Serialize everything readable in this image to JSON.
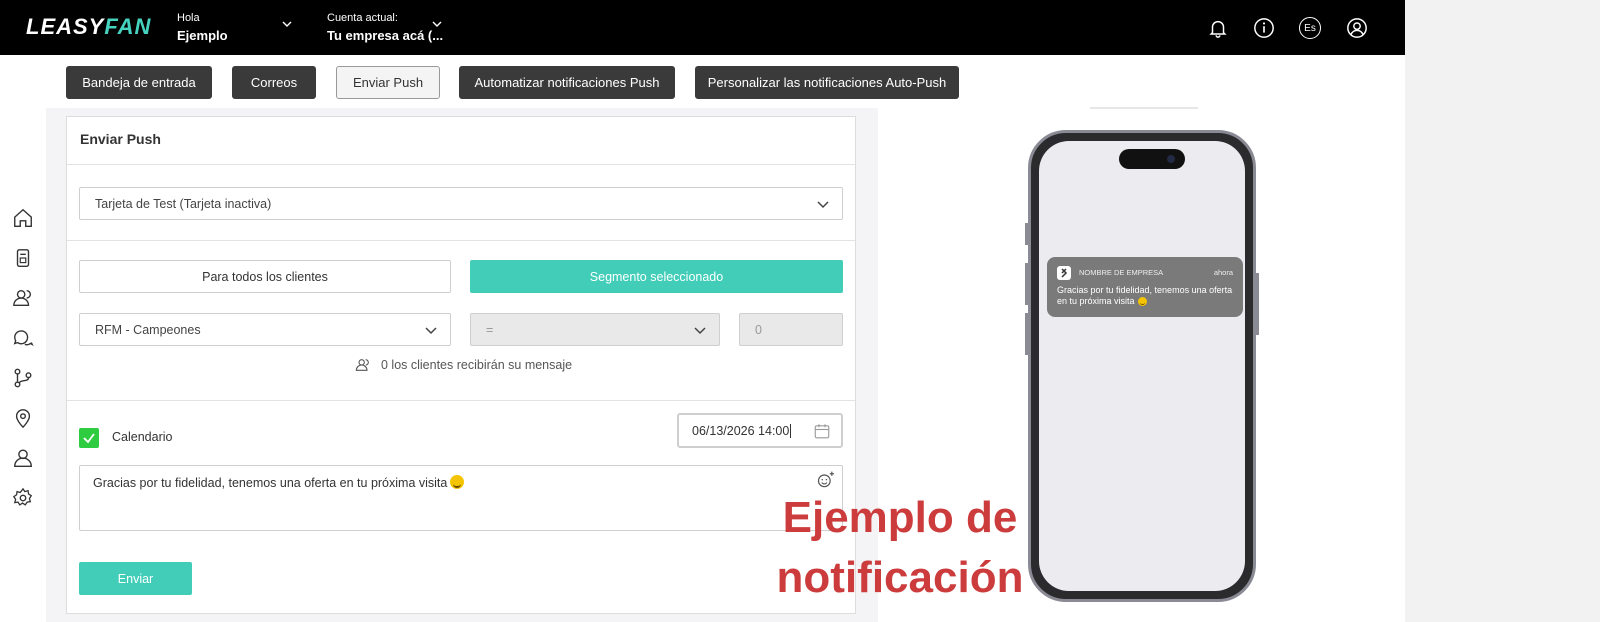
{
  "header": {
    "logo_main": "LEASY",
    "logo_accent": "FAN",
    "greeting_label": "Hola",
    "user_name": "Ejemplo",
    "account_label": "Cuenta actual:",
    "account_name": "Tu empresa acá (..."
  },
  "header_icons": [
    "bell-icon",
    "info-icon",
    "language-icon",
    "user-icon"
  ],
  "language_code": "Es",
  "tabs": [
    {
      "label": "Bandeja de entrada"
    },
    {
      "label": "Correos"
    },
    {
      "label": "Enviar Push"
    },
    {
      "label": "Automatizar notificaciones Push"
    },
    {
      "label": "Personalizar las notificaciones Auto-Push"
    }
  ],
  "sidebar_icons": [
    "home-icon",
    "card-icon",
    "clients-icon",
    "chat-icon",
    "flow-icon",
    "location-icon",
    "person-icon",
    "settings-icon"
  ],
  "form": {
    "title": "Enviar Push",
    "card_select": "Tarjeta de Test (Tarjeta inactiva)",
    "all_clients_label": "Para todos los clientes",
    "segment_label": "Segmento seleccionado",
    "segment_select": "RFM - Campeones",
    "operator_select": "=",
    "value_input": "0",
    "recipients_text": "0 los clientes recibirán su mensaje",
    "calendar_label": "Calendario",
    "calendar_checked": true,
    "date_value": "06/13/2026 14:00",
    "message": "Gracias por tu fidelidad, tenemos una oferta en tu próxima visita",
    "send_label": "Enviar"
  },
  "example_title_line1": "Ejemplo de",
  "example_title_line2": "notificación",
  "phone_notification": {
    "company": "NOMBRE DE EMPRESA",
    "time": "ahora",
    "message": "Gracias por tu fidelidad, tenemos una oferta en tu próxima visita"
  },
  "colors": {
    "accent": "#41cdb8",
    "topbar": "#000000",
    "example_text": "#cc3c3c",
    "check": "#2ecc40"
  }
}
